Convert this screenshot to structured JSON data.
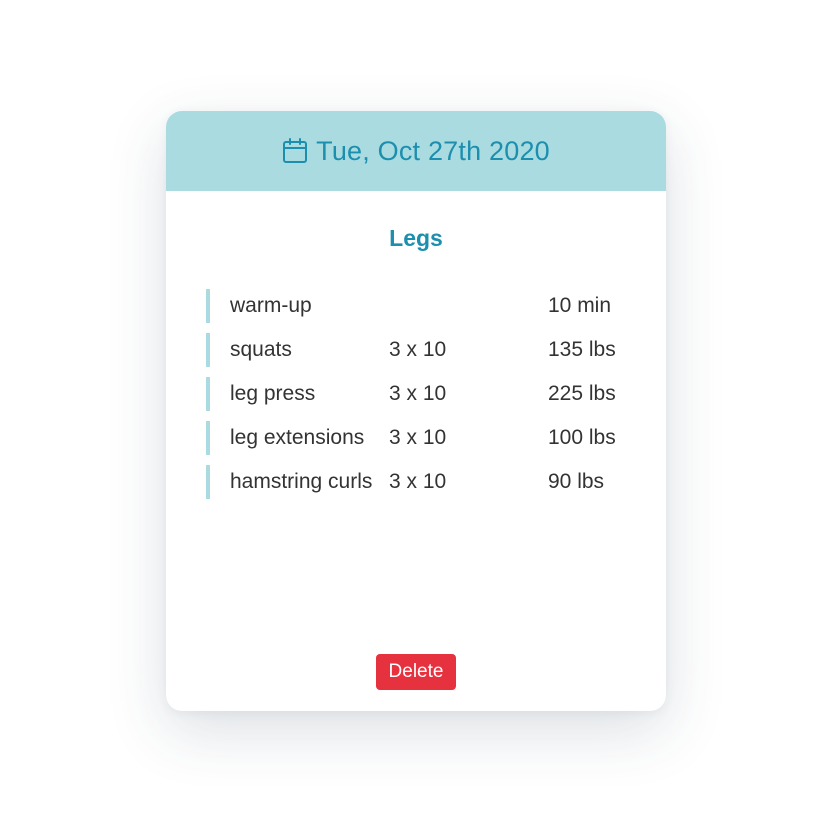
{
  "header": {
    "date": "Tue, Oct 27th 2020",
    "icon": "calendar-icon"
  },
  "workout": {
    "title": "Legs",
    "exercises": [
      {
        "name": "warm-up",
        "sets": "",
        "weight": "10 min"
      },
      {
        "name": "squats",
        "sets": "3 x 10",
        "weight": "135 lbs"
      },
      {
        "name": "leg press",
        "sets": "3 x 10",
        "weight": "225 lbs"
      },
      {
        "name": "leg extensions",
        "sets": "3 x 10",
        "weight": "100 lbs"
      },
      {
        "name": "hamstring curls",
        "sets": "3 x 10",
        "weight": "90 lbs"
      }
    ]
  },
  "actions": {
    "delete_label": "Delete"
  },
  "colors": {
    "accent": "#1d8fae",
    "header_bg": "#a9dbe1",
    "delete_bg": "#e6313e"
  }
}
